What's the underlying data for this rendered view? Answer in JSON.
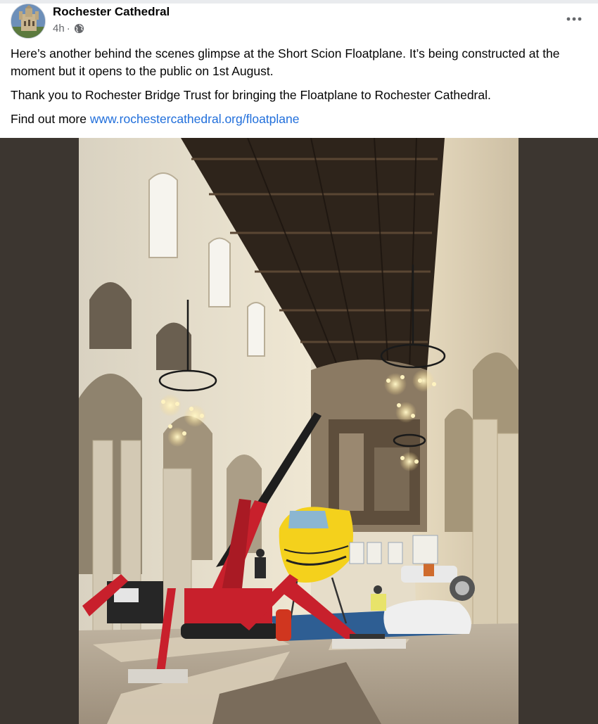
{
  "post": {
    "page_name": "Rochester Cathedral",
    "time": "4h",
    "separator": "·",
    "privacy_icon": "globe-icon",
    "more_icon": "more-horizontal-icon",
    "paragraphs": [
      "Here’s another behind the scenes glimpse at the Short Scion Floatplane. It’s being constructed at the moment but it opens to the public on 1st August.",
      "Thank you to Rochester Bridge Trust for bringing the Floatplane to Rochester Cathedral."
    ],
    "find_out_prefix": "Find out more ",
    "link": "www.rochestercathedral.org/floatplane"
  },
  "photo": {
    "subject": "cathedral-nave-with-yellow-floatplane-and-red-crane"
  },
  "colors": {
    "link": "#216fdb",
    "secondary_text": "#65676b",
    "crane": "#c8202c",
    "floatplane": "#f4d11c",
    "ceiling_wood": "#2e241b",
    "stone": "#e6ddc9"
  }
}
